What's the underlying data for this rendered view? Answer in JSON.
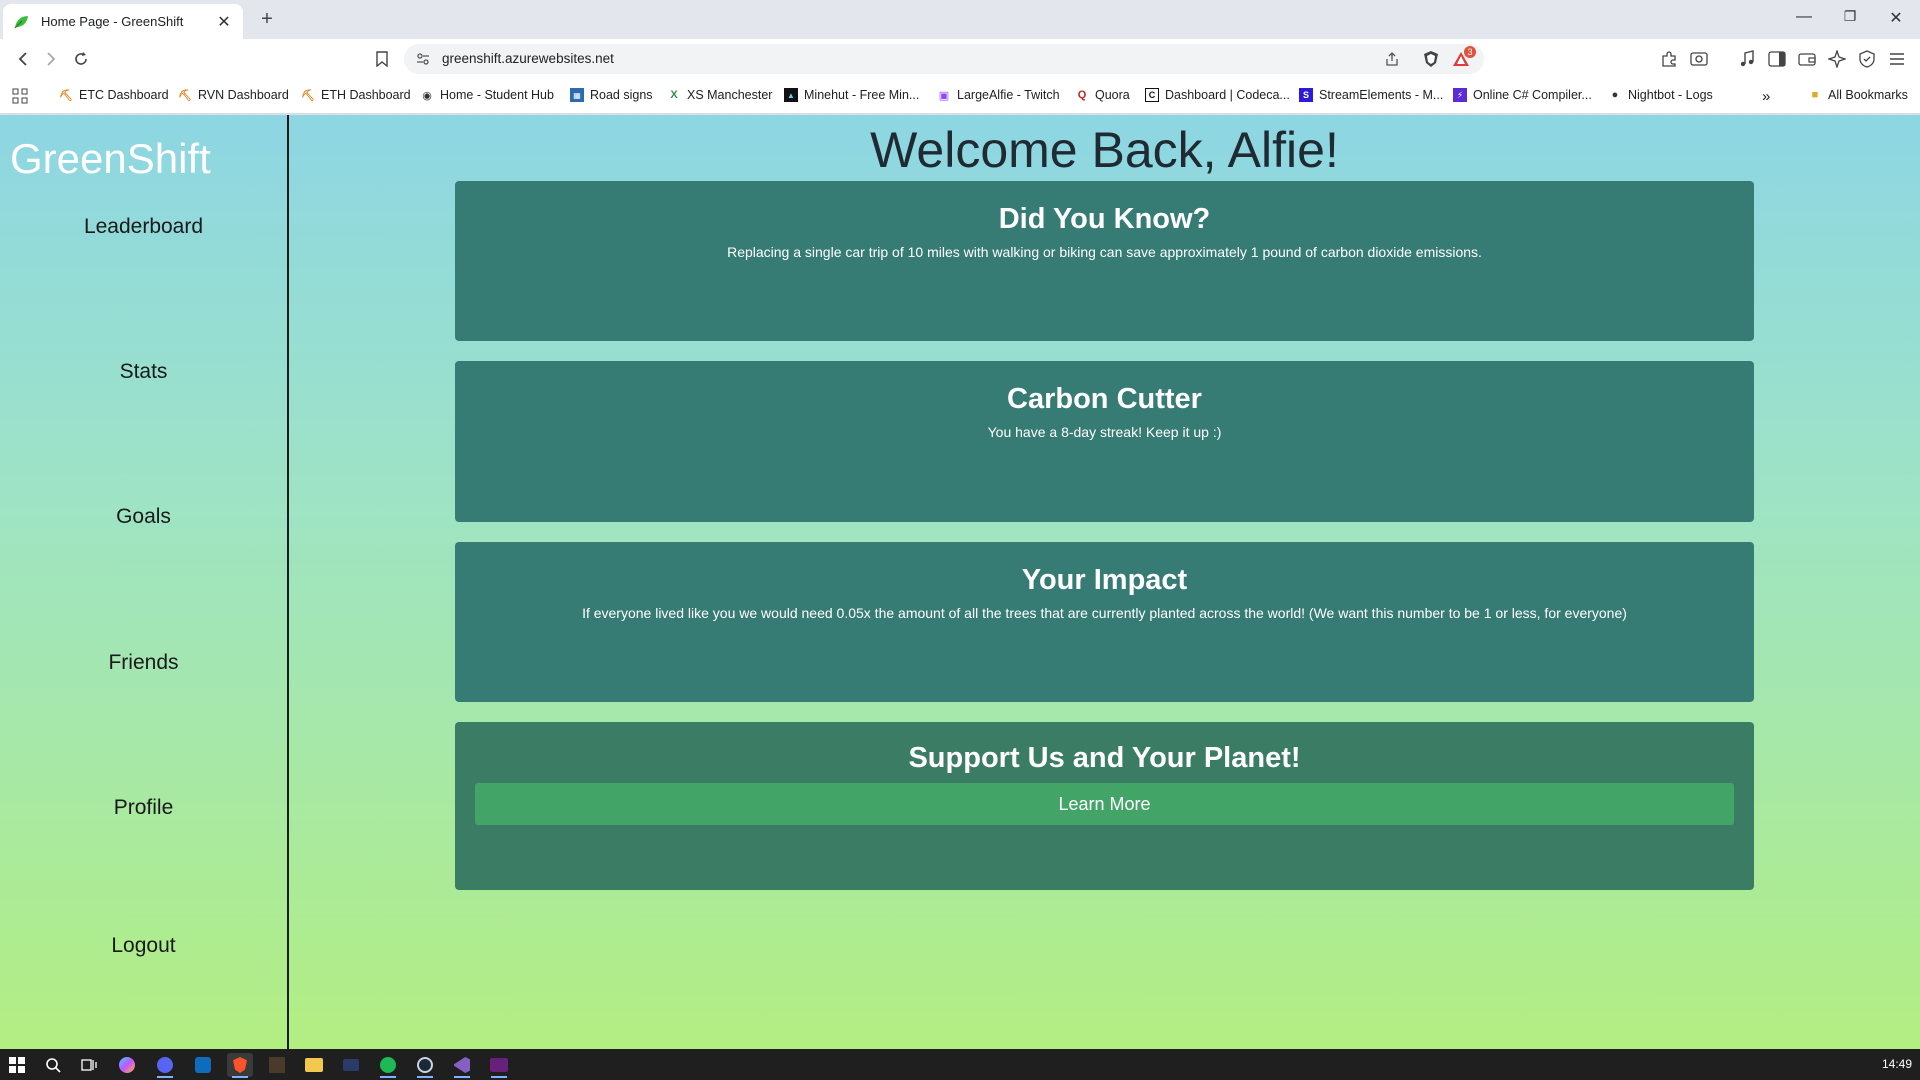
{
  "browser": {
    "tab_title": "Home Page - GreenShift",
    "url": "greenshift.azurewebsites.net",
    "notification_count": "3",
    "bookmarks": [
      "ETC Dashboard",
      "RVN Dashboard",
      "ETH Dashboard",
      "Home - Student Hub",
      "Road signs",
      "XS Manchester",
      "Minehut - Free Min...",
      "LargeAlfie - Twitch",
      "Quora",
      "Dashboard | Codeca...",
      "StreamElements - M...",
      "Online C# Compiler...",
      "Nightbot - Logs"
    ],
    "all_bookmarks": "All Bookmarks"
  },
  "sidebar": {
    "brand": "GreenShift",
    "items": [
      "Leaderboard",
      "Stats",
      "Goals",
      "Friends",
      "Profile",
      "Logout"
    ]
  },
  "main": {
    "welcome": "Welcome Back, Alfie!",
    "cards": [
      {
        "title": "Did You Know?",
        "text": "Replacing a single car trip of 10 miles with walking or biking can save approximately 1 pound of carbon dioxide emissions."
      },
      {
        "title": "Carbon Cutter",
        "text": "You have a 8-day streak! Keep it up :)"
      },
      {
        "title": "Your Impact",
        "text": "If everyone lived like you we would need 0.05x the amount of all the trees that are currently planted across the world! (We want this number to be 1 or less, for everyone)"
      },
      {
        "title": "Support Us and Your Planet!",
        "button": "Learn More"
      }
    ]
  },
  "taskbar": {
    "time": "14:49"
  },
  "colors": {
    "card_bg": "#367c74",
    "button_bg": "#42a467",
    "gradient_top": "#8dd6e3",
    "gradient_bottom": "#b3ee82"
  }
}
